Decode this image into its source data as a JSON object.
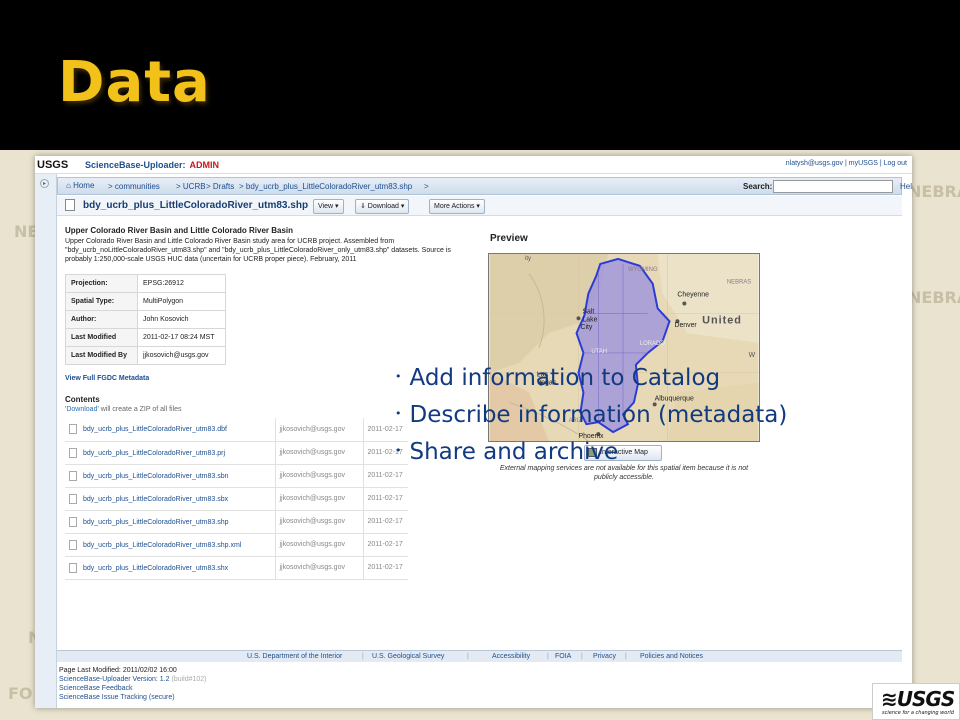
{
  "slide": {
    "title": "Data"
  },
  "background_map": {
    "labels": [
      "NEBRA",
      "NEBRA",
      "NE",
      "FO",
      "N"
    ]
  },
  "app": {
    "logo": "USGS",
    "name": "ScienceBase-Uploader:",
    "role_badge": "ADMIN",
    "user_links": "nlatysh@usgs.gov | myUSGS | Log out"
  },
  "breadcrumb": {
    "home": "Home",
    "items": [
      "> communities",
      "> UCRB",
      "> Drafts",
      "> bdy_ucrb_plus_LittleColoradoRiver_utm83.shp",
      ">"
    ],
    "search_label": "Search:",
    "search_value": "",
    "help": "Help"
  },
  "item": {
    "title": "bdy_ucrb_plus_LittleColoradoRiver_utm83.shp",
    "view_btn": "View ▾",
    "download_btn": "⇓ Download ▾",
    "more_btn": "More Actions ▾",
    "heading": "Upper Colorado River Basin and Little Colorado River Basin",
    "description": "Upper Colorado River Basin and Little Colorado River Basin study area for UCRB project. Assembled from \"bdy_ucrb_noLittleColoradoRiver_utm83.shp\" and \"bdy_ucrb_plus_LittleColoradoRiver_only_utm83.shp\" datasets. Source is probably 1:250,000-scale USGS HUC data (uncertain for UCRB proper piece). February, 2011",
    "metadata": [
      {
        "key": "Projection:",
        "value": "EPSG:26912"
      },
      {
        "key": "Spatial Type:",
        "value": "MultiPolygon"
      },
      {
        "key": "Author:",
        "value": "John Kosovich"
      },
      {
        "key": "Last Modified",
        "value": "2011-02-17 08:24 MST"
      },
      {
        "key": "Last Modified By",
        "value": "jjkosovich@usgs.gov"
      }
    ],
    "fgdc_link": "View Full FGDC Metadata",
    "contents_heading": "Contents",
    "contents_note_link": "'Download'",
    "contents_note_rest": " will create a ZIP of all files",
    "files": [
      {
        "name": "bdy_ucrb_plus_LittleColoradoRiver_utm83.dbf",
        "user": "jjkosovich@usgs.gov",
        "date": "2011-02-17"
      },
      {
        "name": "bdy_ucrb_plus_LittleColoradoRiver_utm83.prj",
        "user": "jjkosovich@usgs.gov",
        "date": "2011-02-17"
      },
      {
        "name": "bdy_ucrb_plus_LittleColoradoRiver_utm83.sbn",
        "user": "jjkosovich@usgs.gov",
        "date": "2011-02-17"
      },
      {
        "name": "bdy_ucrb_plus_LittleColoradoRiver_utm83.sbx",
        "user": "jjkosovich@usgs.gov",
        "date": "2011-02-17"
      },
      {
        "name": "bdy_ucrb_plus_LittleColoradoRiver_utm83.shp",
        "user": "jjkosovich@usgs.gov",
        "date": "2011-02-17"
      },
      {
        "name": "bdy_ucrb_plus_LittleColoradoRiver_utm83.shp.xml",
        "user": "jjkosovich@usgs.gov",
        "date": "2011-02-17"
      },
      {
        "name": "bdy_ucrb_plus_LittleColoradoRiver_utm83.shx",
        "user": "jjkosovich@usgs.gov",
        "date": "2011-02-17"
      }
    ]
  },
  "preview": {
    "heading": "Preview",
    "map_labels": [
      "WYOMING",
      "Cheyenne",
      "NEBRAS",
      "Denver",
      "United",
      "Salt",
      "Lake",
      "City",
      "UTAH",
      "LORADO",
      "Las",
      "Vegas",
      "Albuquerque",
      "ARIZ",
      "Phoenix",
      "W",
      "ity"
    ],
    "interactive_btn": "Interactive Map",
    "note": "External mapping services are not available for this spatial item because it is not publicly accessible."
  },
  "bullets": [
    "Add information to Catalog",
    "Describe information (metadata)",
    "Share and archive"
  ],
  "footer": {
    "links": [
      "U.S. Department of the Interior",
      "U.S. Geological Survey",
      "Accessibility",
      "FOIA",
      "Privacy",
      "Policies and Notices"
    ],
    "separator": "|"
  },
  "page_info": {
    "modified": "Page Last Modified: 2011/02/02 16:00",
    "version_label": "ScienceBase-Uploader Version: 1.2",
    "version_build": "(build#102)",
    "feedback": "ScienceBase Feedback",
    "tracking": "ScienceBase Issue Tracking (secure)"
  },
  "corner_logo": {
    "wordmark": "≋USGS",
    "tagline": "science for a changing world"
  },
  "colors": {
    "title": "#f2c21a",
    "link": "#1d4f8f",
    "bullet_text": "#123a80",
    "basin_fill": "#9a8fe0",
    "basin_outline": "#2b3bd6"
  }
}
